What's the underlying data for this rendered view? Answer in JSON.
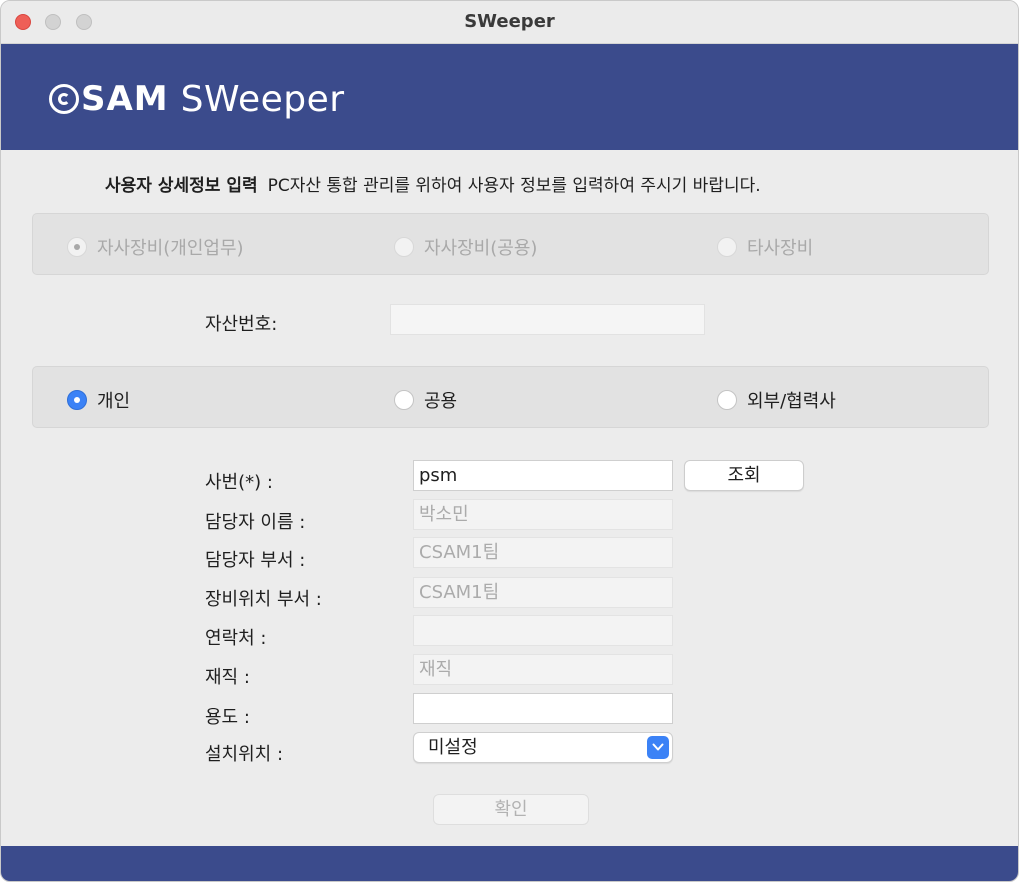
{
  "window": {
    "title": "SWeeper"
  },
  "banner": {
    "logo_brand": "SAM",
    "logo_product": "SWeeper",
    "color": "#3b4b8c"
  },
  "heading": {
    "title": "사용자 상세정보 입력",
    "description": "PC자산 통합 관리를 위하여 사용자 정보를 입력하여 주시기 바랍니다."
  },
  "asset_type": {
    "enabled": false,
    "selected": "자사장비(개인업무)",
    "options": [
      "자사장비(개인업무)",
      "자사장비(공용)",
      "타사장비"
    ]
  },
  "asset_number": {
    "label": "자산번호:",
    "value": ""
  },
  "user_type": {
    "selected": "개인",
    "options": [
      "개인",
      "공용",
      "외부/협력사"
    ]
  },
  "form": {
    "employee_id": {
      "label": "사번(*) :",
      "value": "psm"
    },
    "lookup_button": "조회",
    "manager_name": {
      "label": "담당자 이름 :",
      "value": "박소민"
    },
    "manager_dept": {
      "label": "담당자 부서 :",
      "value": "CSAM1팀"
    },
    "location_dept": {
      "label": "장비위치 부서 :",
      "value": "CSAM1팀"
    },
    "contact": {
      "label": "연락처 :",
      "value": ""
    },
    "employment": {
      "label": "재직 :",
      "value": "재직"
    },
    "purpose": {
      "label": "용도 :",
      "value": ""
    },
    "install_location": {
      "label": "설치위치 :",
      "value": "미설정"
    }
  },
  "confirm_button": "확인",
  "colors": {
    "accent": "#3b82f6",
    "close": "#ee5f57"
  }
}
